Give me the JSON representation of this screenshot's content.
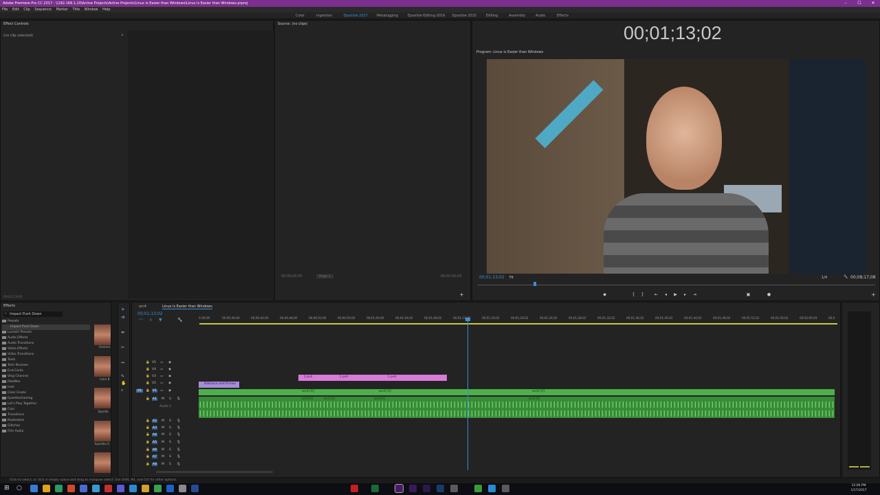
{
  "window": {
    "title": "Adobe Premiere Pro CC 2017 - \\\\192.168.1.20\\Active Projects\\Active Projects\\Linux is Easier than Windows\\Linux is Easier than Windows.prproj",
    "min": "–",
    "max": "☐",
    "close": "✕"
  },
  "menu": [
    "File",
    "Edit",
    "Clip",
    "Sequence",
    "Marker",
    "Title",
    "Window",
    "Help"
  ],
  "workspaces": [
    "Color",
    "Ingestion",
    "Epoxlize 2017",
    "Metalogging",
    "Epoxlize-Editing-2016",
    "Epoxlize 2015",
    "Editing",
    "Assembly",
    "Audio",
    "Effects"
  ],
  "effect_controls": {
    "tab": "Effect Controls",
    "no_clip": "(no clip selected)",
    "timecode": "00;01;13;02"
  },
  "source": {
    "tab": "Source: (no clips)",
    "tc_left": "00;00;00;00",
    "tc_right": "00;00;00;00",
    "page": "Page 1"
  },
  "program": {
    "big_timecode": "00;01;13;02",
    "tab": "Program: Linux is Easier than Windows",
    "tc_current": "00;01;13;02",
    "fit": "Fit",
    "fraction": "1/4",
    "tc_end": "00;08;17;08",
    "colors": {
      "accent": "#3d8ed6",
      "titlebar": "#7b2f8e"
    }
  },
  "effects": {
    "tab": "Effects",
    "search": "Impact Push Down",
    "items": [
      "Presets",
      "Impact Push Down",
      "Lumetri Presets",
      "Audio Effects",
      "Audio Transitions",
      "Video Effects",
      "Video Transitions",
      "Tools",
      "Tech Reviews",
      "End Cards",
      "Vlog Channel",
      "PoleMex",
      "Instr",
      "Color Grade",
      "EposVoxGaming",
      "Let's Play Together",
      "Cool",
      "Transitions",
      "Keyboxbox",
      "Glitches",
      "Film Audio"
    ],
    "thumb_labels": [
      "Gameco",
      "Color B",
      "EposVo",
      "EposVox G",
      ""
    ]
  },
  "timeline": {
    "tab1": "arc4",
    "tab2": "Linux is Easier than Windows",
    "timecode": "00;01;13;02",
    "ruler": [
      "0:36;00",
      "00;00;40;00",
      "00;00;44;00",
      "00;00;48;00",
      "00;00;52;00",
      "00;00;56;00",
      "00;01;00;00",
      "00;01;04;02",
      "00;01;08;02",
      "00;01;12;02",
      "00;01;16;02",
      "00;01;20;02",
      "00;01;24;02",
      "00;01;28;02",
      "00;01;32;02",
      "00;01;36;02",
      "00;01;40;02",
      "00;01;44;02",
      "00;01;48;02",
      "00;01;52;02",
      "00;01;56;02",
      "00;02;00;04",
      "00;0"
    ],
    "video_tracks": [
      "V5",
      "V4",
      "V3",
      "V2",
      "V1"
    ],
    "audio_tracks": [
      "A1",
      "A2",
      "A3",
      "A4",
      "A5",
      "A6",
      "A7",
      "A8"
    ],
    "audio1_name": "Audio 1",
    "pink_clips": [
      "1.psd",
      "1.psd",
      "1.psd"
    ],
    "purple_clip": "Distance and Pl.mov",
    "v1_clips": [
      "arc4 [V]",
      "arc4 [V]",
      "arc4 [V]"
    ],
    "a1_clips": [
      "arc4 [A]",
      "arc4 [A]",
      "arc4 [A]",
      "arc4 [A]"
    ]
  },
  "status": "Click to select, or click in empty space and drag to marquee select. Use Shift, Alt, and Ctrl for other options.",
  "taskbar": {
    "time": "12:06 PM",
    "date": "1/17/2017"
  }
}
